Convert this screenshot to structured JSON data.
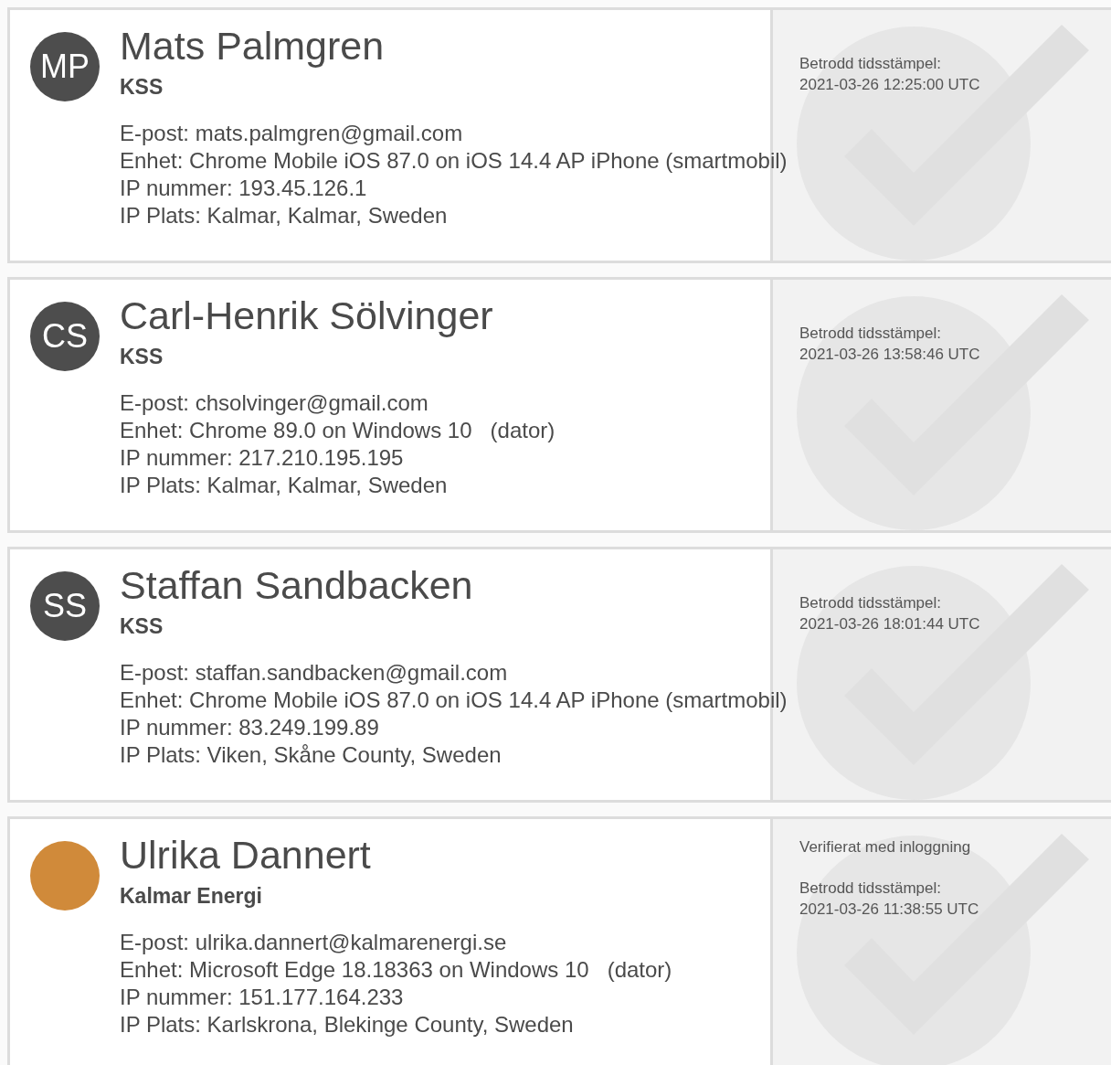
{
  "signatures": [
    {
      "name": "Mats Palmgren",
      "avatar": {
        "kind": "initials",
        "text": "MP"
      },
      "organization": "KSS",
      "details": [
        "E-post: mats.palmgren@gmail.com",
        "Enhet: Chrome Mobile iOS 87.0 on iOS 14.4 AP iPhone (smartmobil)",
        "IP nummer: 193.45.126.1",
        "IP Plats: Kalmar, Kalmar, Sweden"
      ],
      "timestamp_label": "Betrodd tidsstämpel:",
      "timestamp": "2021-03-26 12:25:00 UTC"
    },
    {
      "name": "Carl-Henrik Sölvinger",
      "avatar": {
        "kind": "initials",
        "text": "CS"
      },
      "organization": "KSS",
      "details": [
        "E-post: chsolvinger@gmail.com",
        "Enhet: Chrome 89.0 on Windows 10   (dator)",
        "IP nummer: 217.210.195.195",
        "IP Plats: Kalmar, Kalmar, Sweden"
      ],
      "timestamp_label": "Betrodd tidsstämpel:",
      "timestamp": "2021-03-26 13:58:46 UTC"
    },
    {
      "name": "Staffan Sandbacken",
      "avatar": {
        "kind": "initials",
        "text": "SS"
      },
      "organization": "KSS",
      "details": [
        "E-post: staffan.sandbacken@gmail.com",
        "Enhet: Chrome Mobile iOS 87.0 on iOS 14.4 AP iPhone (smartmobil)",
        "IP nummer: 83.249.199.89",
        "IP Plats: Viken, Skåne County, Sweden"
      ],
      "timestamp_label": "Betrodd tidsstämpel:",
      "timestamp": "2021-03-26 18:01:44 UTC"
    },
    {
      "name": "Ulrika Dannert",
      "avatar": {
        "kind": "photo"
      },
      "organization": "Kalmar Energi",
      "details": [
        "E-post: ulrika.dannert@kalmarenergi.se",
        "Enhet: Microsoft Edge 18.18363 on Windows 10   (dator)",
        "IP nummer: 151.177.164.233",
        "IP Plats: Karlskrona, Blekinge County, Sweden"
      ],
      "verification": "Verifierat med inloggning",
      "timestamp_label": "Betrodd tidsstämpel:",
      "timestamp": "2021-03-26 11:38:55 UTC"
    }
  ]
}
